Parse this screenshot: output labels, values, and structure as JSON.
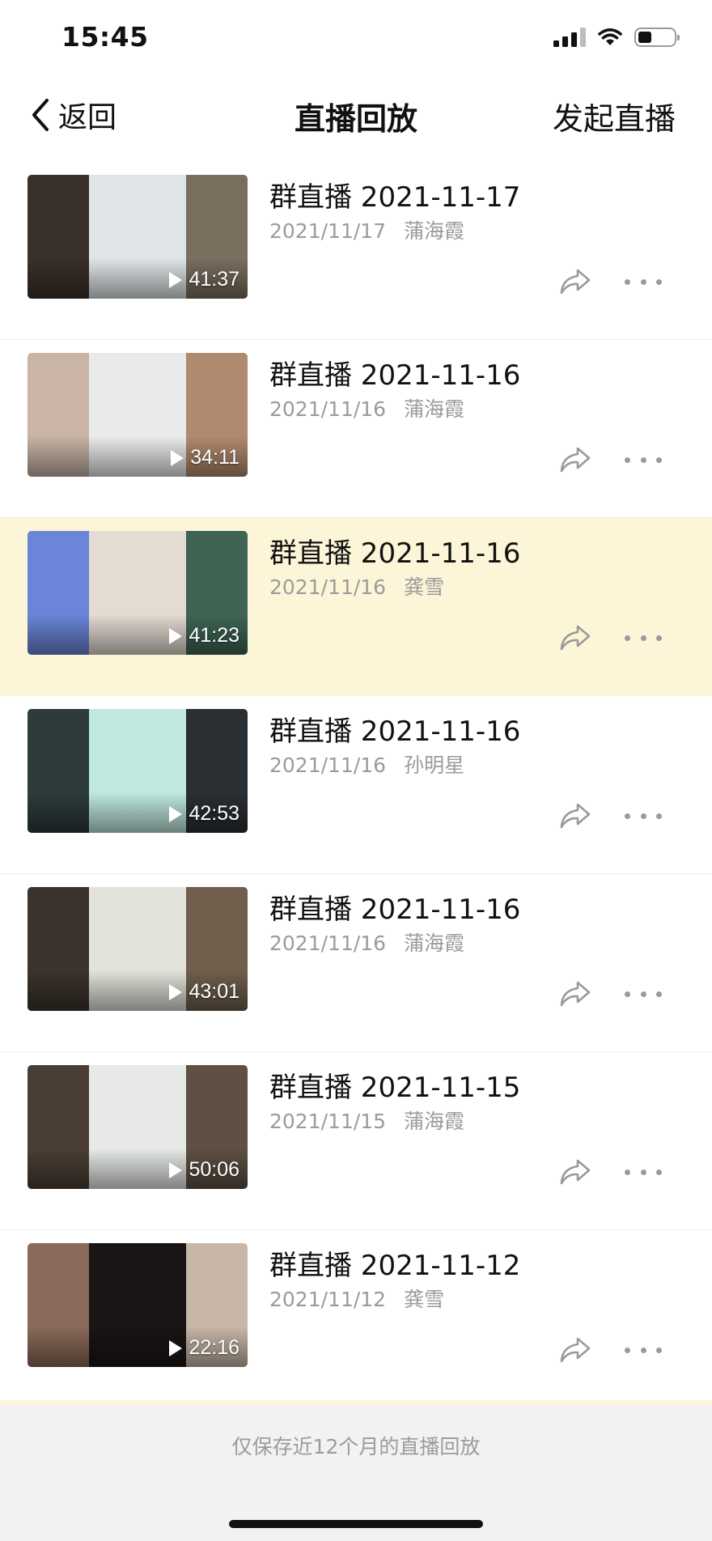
{
  "status_bar": {
    "time": "15:45",
    "battery_level": 0.4
  },
  "nav": {
    "back_label": "返回",
    "title": "直播回放",
    "action_label": "发起直播"
  },
  "list": [
    {
      "title": "群直播 2021-11-17",
      "date": "2021/11/17",
      "host": "蒲海霞",
      "duration": "41:37",
      "highlighted": false,
      "thumb_colors": [
        "#3a302a",
        "#dfe5e6",
        "#7a6e5e"
      ]
    },
    {
      "title": "群直播 2021-11-16",
      "date": "2021/11/16",
      "host": "蒲海霞",
      "duration": "34:11",
      "highlighted": false,
      "thumb_colors": [
        "#c9b4a6",
        "#e9ebea",
        "#b08a6e"
      ]
    },
    {
      "title": "群直播 2021-11-16",
      "date": "2021/11/16",
      "host": "龚雪",
      "duration": "41:23",
      "highlighted": true,
      "thumb_colors": [
        "#6b86d8",
        "#e4dbd2",
        "#3f6454"
      ]
    },
    {
      "title": "群直播 2021-11-16",
      "date": "2021/11/16",
      "host": "孙明星",
      "duration": "42:53",
      "highlighted": false,
      "thumb_colors": [
        "#2d3b3a",
        "#bfe8de",
        "#2a2f33"
      ]
    },
    {
      "title": "群直播 2021-11-16",
      "date": "2021/11/16",
      "host": "蒲海霞",
      "duration": "43:01",
      "highlighted": false,
      "thumb_colors": [
        "#3b332c",
        "#e2e2db",
        "#6f5f4c"
      ]
    },
    {
      "title": "群直播 2021-11-15",
      "date": "2021/11/15",
      "host": "蒲海霞",
      "duration": "50:06",
      "highlighted": false,
      "thumb_colors": [
        "#4a3e34",
        "#e6e9e6",
        "#5e5143"
      ]
    },
    {
      "title": "群直播 2021-11-12",
      "date": "2021/11/12",
      "host": "龚雪",
      "duration": "22:16",
      "highlighted": false,
      "thumb_colors": [
        "#8a6a5a",
        "#1a1515",
        "#c8b7a8"
      ]
    }
  ],
  "footer": {
    "note": "仅保存近12个月的直播回放"
  }
}
